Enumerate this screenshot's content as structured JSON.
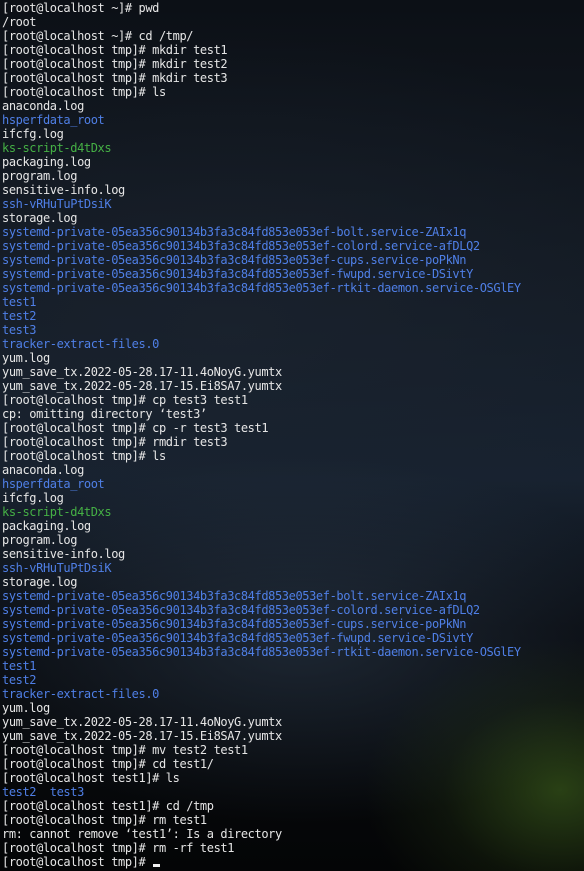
{
  "terminal": {
    "lines": [
      {
        "text": "[root@localhost ~]# pwd",
        "color": "white"
      },
      {
        "text": "/root",
        "color": "white"
      },
      {
        "text": "[root@localhost ~]# cd /tmp/",
        "color": "white"
      },
      {
        "text": "[root@localhost tmp]# mkdir test1",
        "color": "white"
      },
      {
        "text": "[root@localhost tmp]# mkdir test2",
        "color": "white"
      },
      {
        "text": "[root@localhost tmp]# mkdir test3",
        "color": "white"
      },
      {
        "text": "[root@localhost tmp]# ls",
        "color": "white"
      },
      {
        "text": "anaconda.log",
        "color": "white"
      },
      {
        "text": "hsperfdata_root",
        "color": "blue"
      },
      {
        "text": "ifcfg.log",
        "color": "white"
      },
      {
        "text": "ks-script-d4tDxs",
        "color": "green"
      },
      {
        "text": "packaging.log",
        "color": "white"
      },
      {
        "text": "program.log",
        "color": "white"
      },
      {
        "text": "sensitive-info.log",
        "color": "white"
      },
      {
        "text": "ssh-vRHuTuPtDsiK",
        "color": "blue"
      },
      {
        "text": "storage.log",
        "color": "white"
      },
      {
        "text": "systemd-private-05ea356c90134b3fa3c84fd853e053ef-bolt.service-ZAIx1q",
        "color": "blue"
      },
      {
        "text": "systemd-private-05ea356c90134b3fa3c84fd853e053ef-colord.service-afDLQ2",
        "color": "blue"
      },
      {
        "text": "systemd-private-05ea356c90134b3fa3c84fd853e053ef-cups.service-poPkNn",
        "color": "blue"
      },
      {
        "text": "systemd-private-05ea356c90134b3fa3c84fd853e053ef-fwupd.service-DSivtY",
        "color": "blue"
      },
      {
        "text": "systemd-private-05ea356c90134b3fa3c84fd853e053ef-rtkit-daemon.service-OSGlEY",
        "color": "blue"
      },
      {
        "text": "test1",
        "color": "blue"
      },
      {
        "text": "test2",
        "color": "blue"
      },
      {
        "text": "test3",
        "color": "blue"
      },
      {
        "text": "tracker-extract-files.0",
        "color": "blue"
      },
      {
        "text": "yum.log",
        "color": "white"
      },
      {
        "text": "yum_save_tx.2022-05-28.17-11.4oNoyG.yumtx",
        "color": "white"
      },
      {
        "text": "yum_save_tx.2022-05-28.17-15.Ei8SA7.yumtx",
        "color": "white"
      },
      {
        "text": "[root@localhost tmp]# cp test3 test1",
        "color": "white"
      },
      {
        "text": "cp: omitting directory ‘test3’",
        "color": "white"
      },
      {
        "text": "[root@localhost tmp]# cp -r test3 test1",
        "color": "white"
      },
      {
        "text": "[root@localhost tmp]# rmdir test3",
        "color": "white"
      },
      {
        "text": "[root@localhost tmp]# ls",
        "color": "white"
      },
      {
        "text": "anaconda.log",
        "color": "white"
      },
      {
        "text": "hsperfdata_root",
        "color": "blue"
      },
      {
        "text": "ifcfg.log",
        "color": "white"
      },
      {
        "text": "ks-script-d4tDxs",
        "color": "green"
      },
      {
        "text": "packaging.log",
        "color": "white"
      },
      {
        "text": "program.log",
        "color": "white"
      },
      {
        "text": "sensitive-info.log",
        "color": "white"
      },
      {
        "text": "ssh-vRHuTuPtDsiK",
        "color": "blue"
      },
      {
        "text": "storage.log",
        "color": "white"
      },
      {
        "text": "systemd-private-05ea356c90134b3fa3c84fd853e053ef-bolt.service-ZAIx1q",
        "color": "blue"
      },
      {
        "text": "systemd-private-05ea356c90134b3fa3c84fd853e053ef-colord.service-afDLQ2",
        "color": "blue"
      },
      {
        "text": "systemd-private-05ea356c90134b3fa3c84fd853e053ef-cups.service-poPkNn",
        "color": "blue"
      },
      {
        "text": "systemd-private-05ea356c90134b3fa3c84fd853e053ef-fwupd.service-DSivtY",
        "color": "blue"
      },
      {
        "text": "systemd-private-05ea356c90134b3fa3c84fd853e053ef-rtkit-daemon.service-OSGlEY",
        "color": "blue"
      },
      {
        "text": "test1",
        "color": "blue"
      },
      {
        "text": "test2",
        "color": "blue"
      },
      {
        "text": "tracker-extract-files.0",
        "color": "blue"
      },
      {
        "text": "yum.log",
        "color": "white"
      },
      {
        "text": "yum_save_tx.2022-05-28.17-11.4oNoyG.yumtx",
        "color": "white"
      },
      {
        "text": "yum_save_tx.2022-05-28.17-15.Ei8SA7.yumtx",
        "color": "white"
      },
      {
        "text": "[root@localhost tmp]# mv test2 test1",
        "color": "white"
      },
      {
        "text": "[root@localhost tmp]# cd test1/",
        "color": "white"
      },
      {
        "text": "[root@localhost test1]# ls",
        "color": "white"
      },
      {
        "text": "test2  test3",
        "color": "blue"
      },
      {
        "text": "[root@localhost test1]# cd /tmp",
        "color": "white"
      },
      {
        "text": "[root@localhost tmp]# rm test1",
        "color": "white"
      },
      {
        "text": "rm: cannot remove ‘test1’: Is a directory",
        "color": "white"
      },
      {
        "text": "[root@localhost tmp]# rm -rf test1",
        "color": "white"
      }
    ],
    "prompt": "[root@localhost tmp]# "
  },
  "colors": {
    "foreground": "#e6e6e6",
    "directory": "#4f7fe6",
    "executable": "#45b045",
    "cursor": "#f0f0f0"
  }
}
